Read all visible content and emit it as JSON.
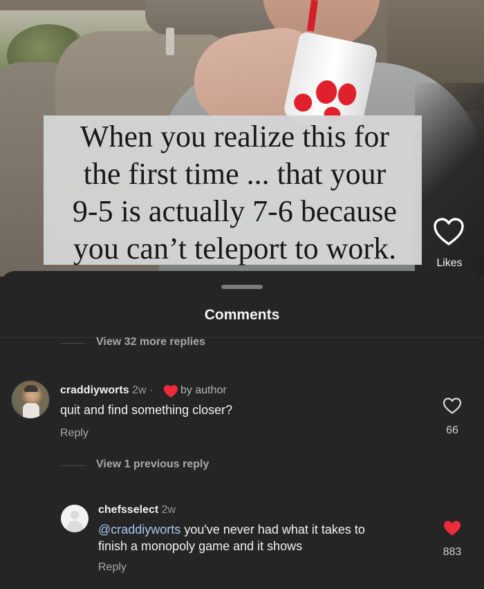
{
  "video": {
    "caption_lines": [
      "When you realize this for",
      "the first time ... that your",
      "9-5 is actually 7-6 because",
      "you can’t teleport to work."
    ],
    "likes_label": "Likes",
    "like_icon": "heart-outline-icon"
  },
  "sheet": {
    "title": "Comments"
  },
  "comments": {
    "view_more_top": "View 32 more replies",
    "first": {
      "username": "craddiyworts",
      "time": "2w",
      "separator": "·",
      "author_badge": "by author",
      "text": "quit and find something closer?",
      "reply_label": "Reply",
      "like_count": "66",
      "liked": false
    },
    "view_previous": "View 1 previous reply",
    "reply": {
      "username": "chefsselect",
      "time": "2w",
      "mention": "@craddiyworts",
      "text_rest": " you've never had what it takes to",
      "text_line2": "finish a monopoly game and it shows",
      "reply_label": "Reply",
      "like_count": "883",
      "liked": true
    }
  },
  "colors": {
    "sheet_bg": "#252526",
    "heart_red": "#ee2b3b",
    "mention_blue": "#a8c8f0"
  }
}
